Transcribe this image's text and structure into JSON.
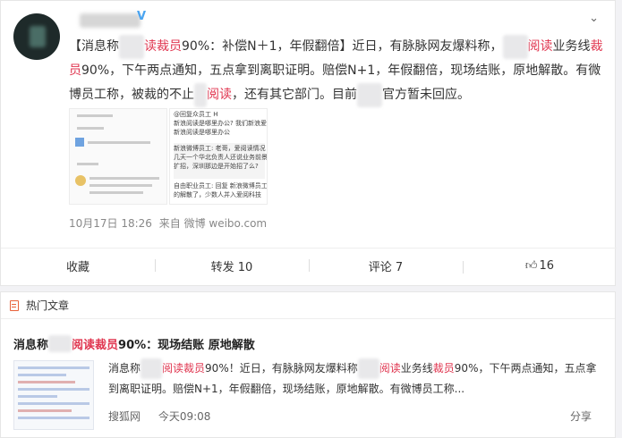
{
  "post": {
    "verify_badge": "V",
    "text_segments": [
      {
        "t": "【消息称",
        "c": ""
      },
      {
        "t": "　　",
        "c": "blur"
      },
      {
        "t": "读裁员",
        "c": "hl"
      },
      {
        "t": "90%：补偿N＋1，年假翻倍】近日，有脉脉网友爆料称，",
        "c": ""
      },
      {
        "t": "　　",
        "c": "blur"
      },
      {
        "t": "阅读",
        "c": "hl"
      },
      {
        "t": "业务线",
        "c": ""
      },
      {
        "t": "裁员",
        "c": "hl"
      },
      {
        "t": "90%，下午两点通知，五点拿到离职证明。赔偿N+1，年假翻倍，现场结账，原地解散。有微博员工称，被裁的不止",
        "c": ""
      },
      {
        "t": "　",
        "c": "blur"
      },
      {
        "t": "阅读",
        "c": "hl"
      },
      {
        "t": "，还有其它部门。目前",
        "c": ""
      },
      {
        "t": "　　",
        "c": "blur"
      },
      {
        "t": "官方暂未回应。",
        "c": ""
      }
    ],
    "thumb2_lines": [
      "@回复众员工 H",
      "新浪阅读是哪里办公? 我们新浪爱阅读",
      "新浪阅读是哪里办公",
      "新浪微博员工: 老哥，爱阅读情况",
      "几天一个华北负责人还说业务前景",
      "扩招，深圳那边是开始招了么?",
      "自由职业员工: 回复 新浪微博员工",
      "的解散了，少数人并入爱阅科技"
    ],
    "time": "10月17日 18:26",
    "source": "来自 微博 weibo.com",
    "actions": {
      "favorite": "收藏",
      "repost": "转发 10",
      "comment": "评论 7",
      "like_count": "16"
    }
  },
  "hot": {
    "header": "热门文章",
    "title_segments": [
      {
        "t": "消息称",
        "c": ""
      },
      {
        "t": "　　",
        "c": "blur"
      },
      {
        "t": "阅读裁员",
        "c": "hl"
      },
      {
        "t": "90%：现场结账 原地解散",
        "c": ""
      }
    ],
    "summary_segments": [
      {
        "t": "消息称",
        "c": ""
      },
      {
        "t": "　　",
        "c": "blur"
      },
      {
        "t": "阅读裁员",
        "c": "hl"
      },
      {
        "t": "90%！近日，有脉脉网友爆料称",
        "c": ""
      },
      {
        "t": "　　",
        "c": "blur"
      },
      {
        "t": "阅读",
        "c": "hl"
      },
      {
        "t": "业务线",
        "c": ""
      },
      {
        "t": "裁员",
        "c": "hl"
      },
      {
        "t": "90%，下午两点通知，五点拿到离职证明。赔偿N+1，年假翻倍，现场结账，原地解散。有微博员工称...",
        "c": ""
      }
    ],
    "source": "搜狐网",
    "time": "今天09:08",
    "share": "分享"
  },
  "icons": {
    "chevron": "chevron-down-icon",
    "like": "thumbs-up-icon",
    "doc": "document-icon"
  }
}
